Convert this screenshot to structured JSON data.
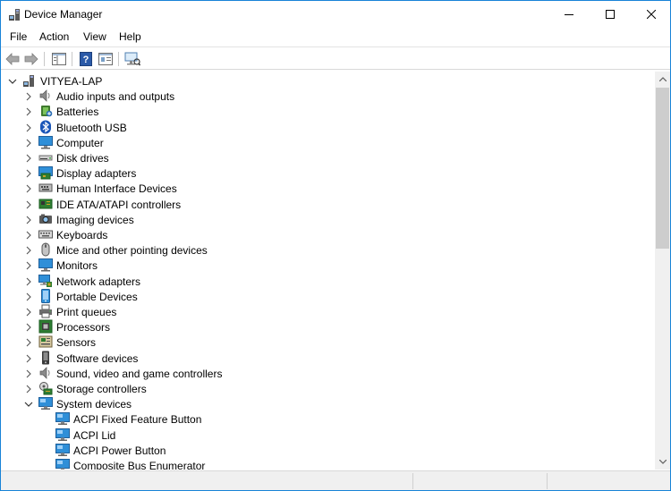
{
  "window": {
    "title": "Device Manager",
    "app_icon": "device-manager-icon"
  },
  "menu": [
    {
      "label": "File"
    },
    {
      "label": "Action"
    },
    {
      "label": "View"
    },
    {
      "label": "Help"
    }
  ],
  "toolbar": [
    "back-arrow-icon",
    "forward-arrow-icon",
    "show-hide-console-tree-icon",
    "help-icon",
    "properties-icon",
    "scan-hardware-icon"
  ],
  "tree": {
    "root": {
      "label": "VITYEA-LAP",
      "icon": "computer-icon",
      "expanded": true
    },
    "categories": [
      {
        "label": "Audio inputs and outputs",
        "icon": "speaker-icon",
        "expanded": false
      },
      {
        "label": "Batteries",
        "icon": "battery-icon",
        "expanded": false
      },
      {
        "label": "Bluetooth USB",
        "icon": "bluetooth-icon",
        "expanded": false
      },
      {
        "label": "Computer",
        "icon": "monitor-icon",
        "expanded": false
      },
      {
        "label": "Disk drives",
        "icon": "disk-drive-icon",
        "expanded": false
      },
      {
        "label": "Display adapters",
        "icon": "display-adapter-icon",
        "expanded": false
      },
      {
        "label": "Human Interface Devices",
        "icon": "hid-icon",
        "expanded": false
      },
      {
        "label": "IDE ATA/ATAPI controllers",
        "icon": "ide-controller-icon",
        "expanded": false
      },
      {
        "label": "Imaging devices",
        "icon": "camera-icon",
        "expanded": false
      },
      {
        "label": "Keyboards",
        "icon": "keyboard-icon",
        "expanded": false
      },
      {
        "label": "Mice and other pointing devices",
        "icon": "mouse-icon",
        "expanded": false
      },
      {
        "label": "Monitors",
        "icon": "monitor-icon",
        "expanded": false
      },
      {
        "label": "Network adapters",
        "icon": "network-adapter-icon",
        "expanded": false
      },
      {
        "label": "Portable Devices",
        "icon": "portable-device-icon",
        "expanded": false
      },
      {
        "label": "Print queues",
        "icon": "printer-icon",
        "expanded": false
      },
      {
        "label": "Processors",
        "icon": "processor-icon",
        "expanded": false
      },
      {
        "label": "Sensors",
        "icon": "sensor-icon",
        "expanded": false
      },
      {
        "label": "Software devices",
        "icon": "software-device-icon",
        "expanded": false
      },
      {
        "label": "Sound, video and game controllers",
        "icon": "speaker-icon",
        "expanded": false
      },
      {
        "label": "Storage controllers",
        "icon": "storage-controller-icon",
        "expanded": false
      },
      {
        "label": "System devices",
        "icon": "system-device-icon",
        "expanded": true
      }
    ],
    "system_devices": [
      {
        "label": "ACPI Fixed Feature Button",
        "icon": "system-device-icon"
      },
      {
        "label": "ACPI Lid",
        "icon": "system-device-icon"
      },
      {
        "label": "ACPI Power Button",
        "icon": "system-device-icon"
      },
      {
        "label": "Composite Bus Enumerator",
        "icon": "system-device-icon"
      }
    ]
  },
  "colors": {
    "accent_border": "#1883d7",
    "icon_blue": "#2f8fd8",
    "scrollbar_track": "#f0f0f0",
    "scrollbar_thumb": "#cdcdcd"
  }
}
